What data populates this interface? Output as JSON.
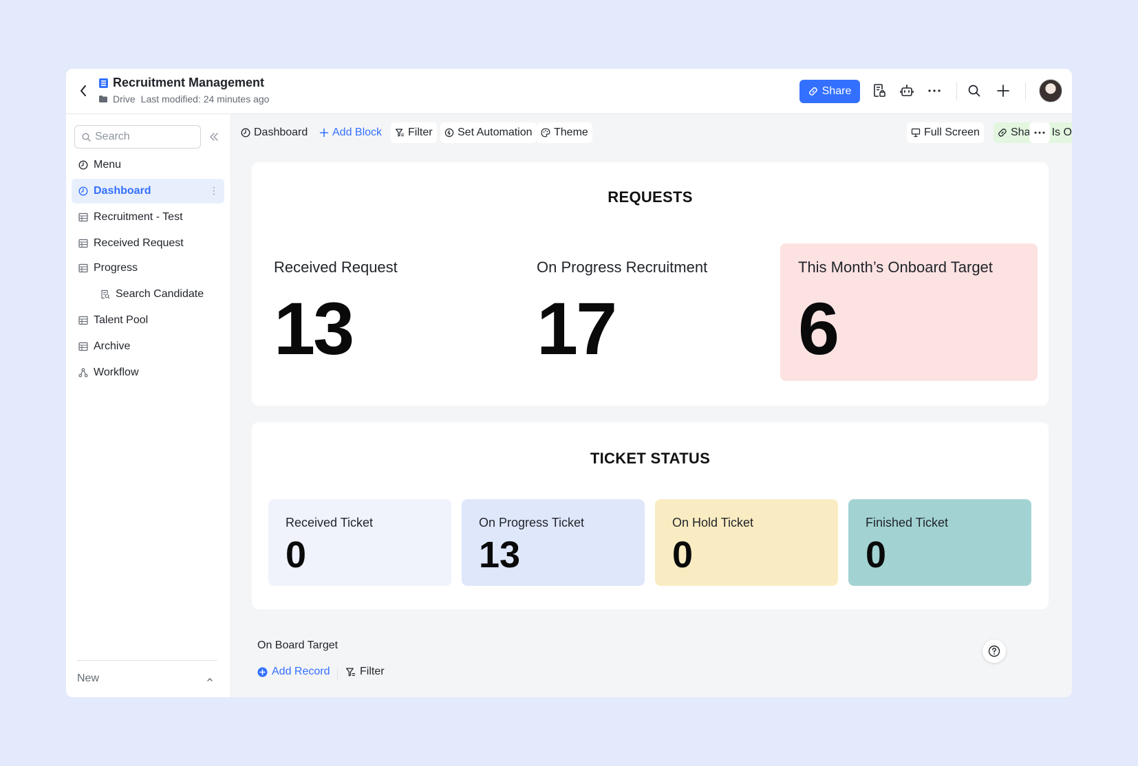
{
  "header": {
    "title": "Recruitment Management",
    "location": "Drive",
    "modified": "Last modified: 24 minutes ago",
    "share_label": "Share"
  },
  "sidebar": {
    "search_placeholder": "Search",
    "items": [
      {
        "label": "Menu",
        "icon": "dashboard-icon"
      },
      {
        "label": "Dashboard",
        "icon": "dashboard-icon",
        "active": true
      },
      {
        "label": "Recruitment - Test",
        "icon": "table-icon"
      },
      {
        "label": "Received Request",
        "icon": "table-icon"
      },
      {
        "label": "Progress",
        "icon": "table-icon"
      },
      {
        "label": "Search Candidate",
        "icon": "form-icon"
      },
      {
        "label": "Talent Pool",
        "icon": "table-icon"
      },
      {
        "label": "Archive",
        "icon": "table-icon"
      },
      {
        "label": "Workflow",
        "icon": "workflow-icon"
      }
    ],
    "new_label": "New"
  },
  "toolbar": {
    "dashboard": "Dashboard",
    "add_block": "Add Block",
    "filter": "Filter",
    "set_automation": "Set Automation",
    "theme": "Theme",
    "full_screen": "Full Screen",
    "sharing": "Sharing Is On"
  },
  "requests": {
    "title": "REQUESTS",
    "metrics": [
      {
        "label": "Received Request",
        "value": "13",
        "color": "#ffffff"
      },
      {
        "label": "On Progress Recruitment",
        "value": "17",
        "color": "#ffffff"
      },
      {
        "label": "This Month’s Onboard Target",
        "value": "6",
        "color": "#fde2e2"
      }
    ]
  },
  "ticket_status": {
    "title": "TICKET STATUS",
    "tickets": [
      {
        "label": "Received Ticket",
        "value": "0",
        "color": "#f0f2fc"
      },
      {
        "label": "On Progress Ticket",
        "value": "13",
        "color": "#dfe7fb"
      },
      {
        "label": "On Hold Ticket",
        "value": "0",
        "color": "#faecc2"
      },
      {
        "label": "Finished Ticket",
        "value": "0",
        "color": "#a2d3d2"
      }
    ]
  },
  "onboard": {
    "title": "On Board Target",
    "add_record": "Add Record",
    "filter": "Filter"
  },
  "colors": {
    "accent": "#3370ff",
    "background": "#e2eafb"
  }
}
